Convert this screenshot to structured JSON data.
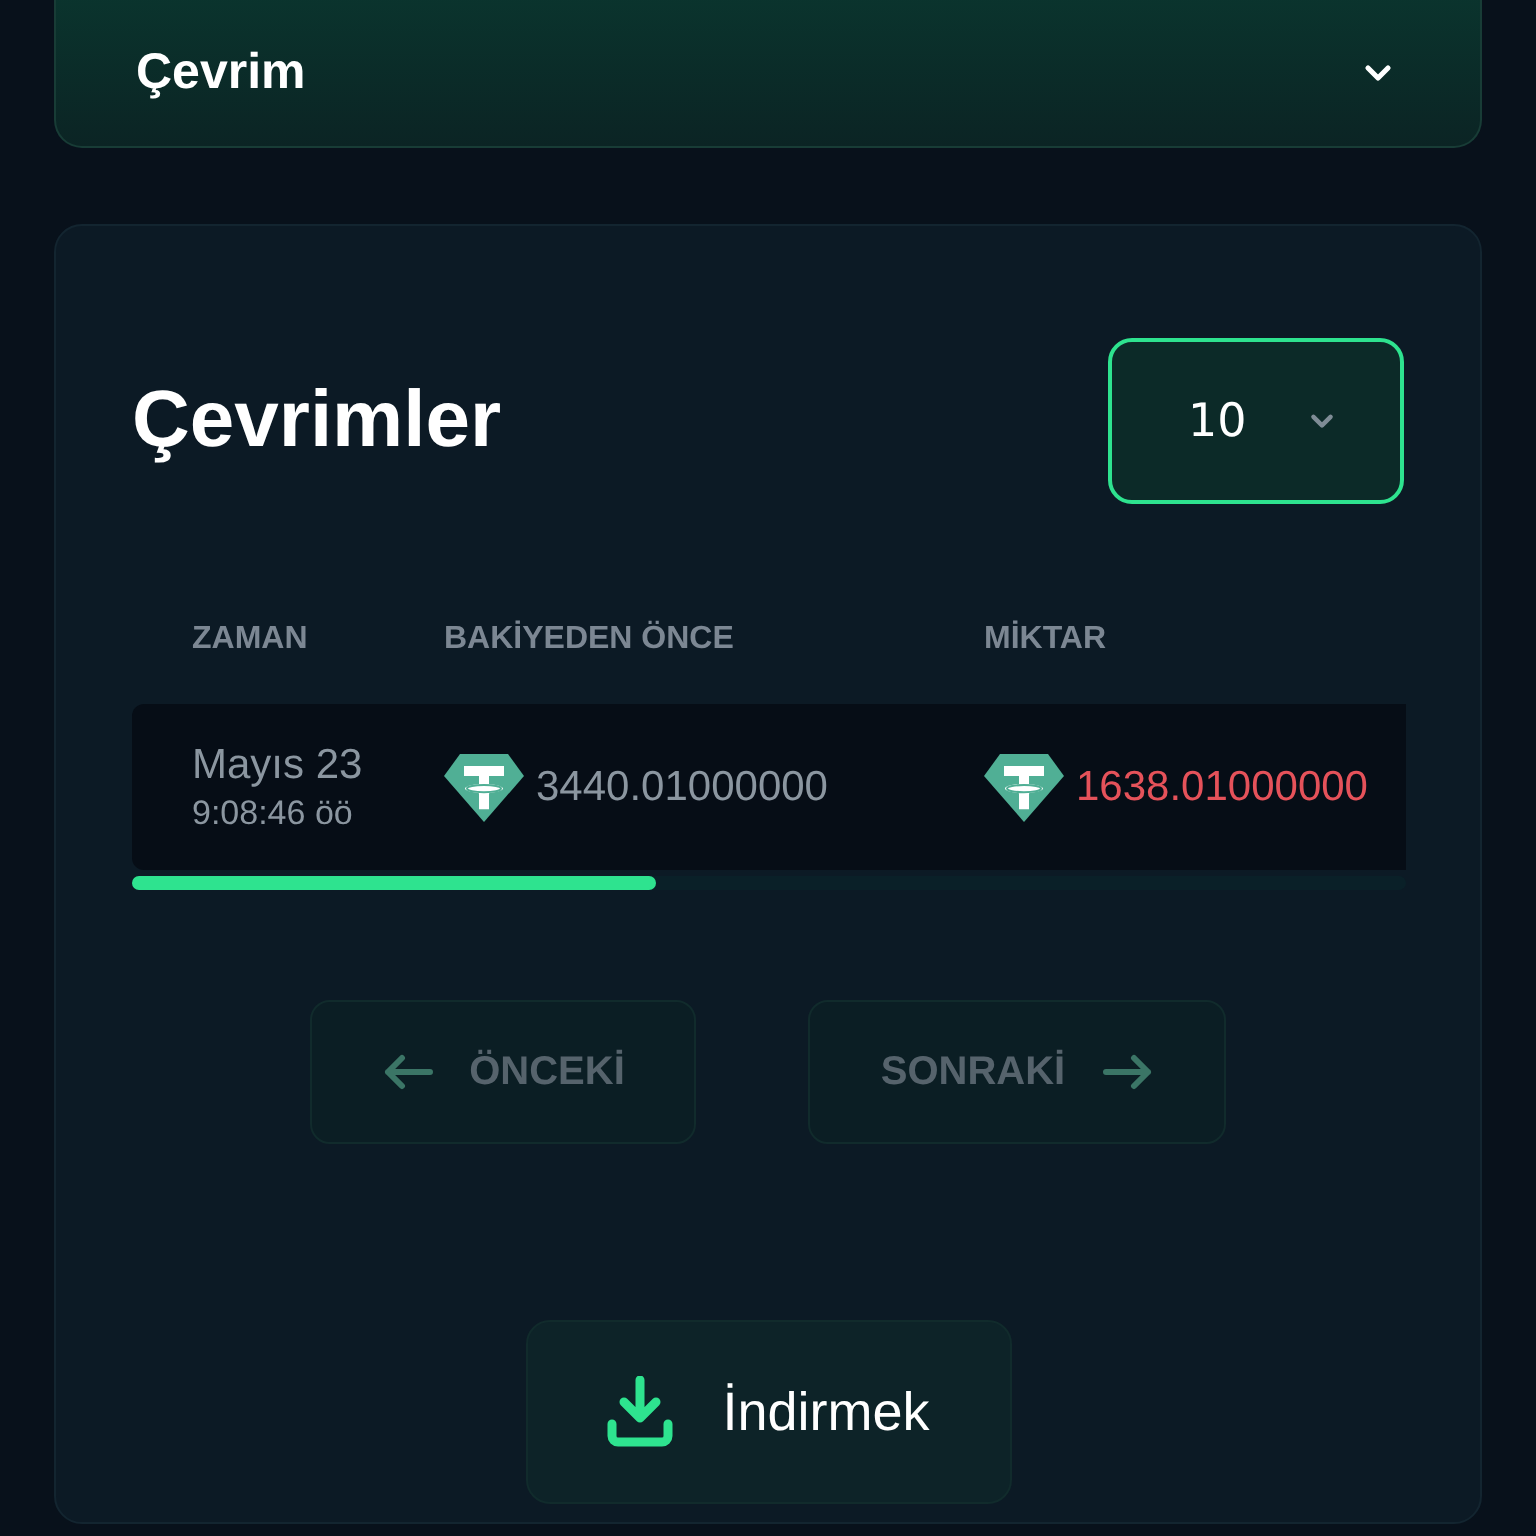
{
  "dropdown": {
    "value": "Çevrim",
    "expanded": false
  },
  "panel": {
    "title": "Çevrimler",
    "page_size": "10"
  },
  "table": {
    "columns": [
      "ZAMAN",
      "BAKİYEDEN ÖNCE",
      "MİKTAR"
    ],
    "rows": [
      {
        "date": "Mayıs 23",
        "time": "9:08:46 öö",
        "balance_before": "3440.01000000",
        "amount": "1638.01000000",
        "amount_negative": true
      }
    ]
  },
  "pagination": [
    {
      "label": "ÖNCEKİ",
      "kind": "prev",
      "disabled": true
    },
    {
      "label": "SONRAKİ",
      "kind": "next",
      "disabled": true
    }
  ],
  "download_button": {
    "label": "İndirmek"
  }
}
